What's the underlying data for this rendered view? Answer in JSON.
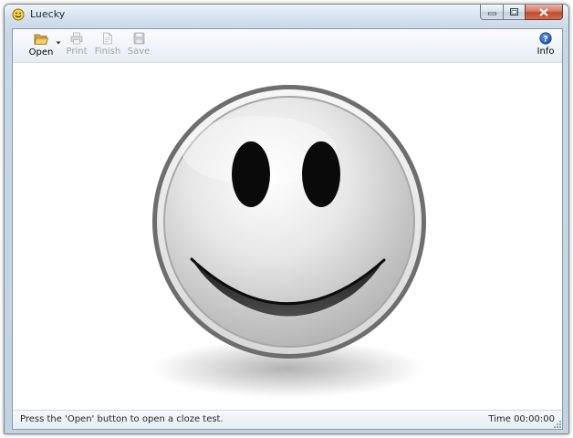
{
  "window": {
    "title": "Luecky",
    "controls": {
      "minimize": "minimize",
      "maximize": "maximize",
      "close": "close"
    }
  },
  "toolbar": {
    "open_label": "Open",
    "print_label": "Print",
    "finish_label": "Finish",
    "save_label": "Save",
    "info_label": "Info"
  },
  "icons": {
    "app": "smiley-icon",
    "open": "folder-open-icon",
    "open_dropdown": "chevron-down-icon",
    "print": "printer-icon",
    "finish": "document-icon",
    "save": "floppy-disk-icon",
    "info": "help-icon",
    "canvas": "smiley-face-icon"
  },
  "status": {
    "message": "Press the 'Open' button to open a cloze test.",
    "time": "Time 00:00:00"
  },
  "colors": {
    "accent": "#1f4fb3",
    "disabled_text": "#9aa3ad",
    "close_button": "#c24a2f"
  }
}
